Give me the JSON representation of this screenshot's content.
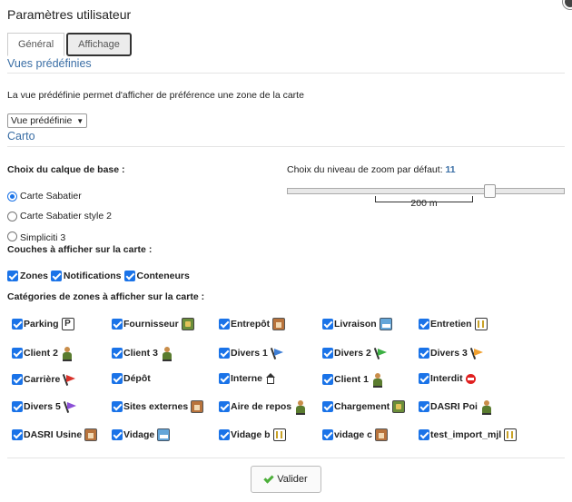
{
  "dialog": {
    "title": "Paramètres utilisateur"
  },
  "tabs": [
    {
      "label": "Général"
    },
    {
      "label": "Affichage"
    }
  ],
  "vues": {
    "section_title": "Vues prédéfinies",
    "description": "La vue prédéfinie permet d'afficher de préférence une zone de la carte",
    "select_value": "Vue prédéfinie"
  },
  "carto": {
    "section_title": "Carto",
    "base_layer_label": "Choix du calque de base :",
    "base_layers": [
      {
        "label": "Carte Sabatier",
        "checked": true
      },
      {
        "label": "Carte Sabatier style 2",
        "checked": false
      },
      {
        "label": "Simpliciti 3",
        "checked": false
      }
    ],
    "zoom_label": "Choix du niveau de zoom par défaut:",
    "zoom_value": "11",
    "scale_label": "200 m",
    "layers_label": "Couches à afficher sur la carte :",
    "layers": [
      "Zones",
      "Notifications",
      "Conteneurs"
    ],
    "categories_label": "Catégories de zones à afficher sur la carte :",
    "categories": [
      {
        "label": "Parking",
        "icon": "parking-icon"
      },
      {
        "label": "Fournisseur",
        "icon": "box-icon"
      },
      {
        "label": "Entrepôt",
        "icon": "warehouse-icon"
      },
      {
        "label": "Livraison",
        "icon": "truck-icon"
      },
      {
        "label": "Entretien",
        "icon": "tools-icon"
      },
      {
        "label": "Client 2",
        "icon": "person-icon"
      },
      {
        "label": "Client 3",
        "icon": "person-icon"
      },
      {
        "label": "Divers 1",
        "icon": "blue-flag-icon"
      },
      {
        "label": "Divers 2",
        "icon": "green-flag-icon"
      },
      {
        "label": "Divers 3",
        "icon": "orange-flag-icon"
      },
      {
        "label": "Carrière",
        "icon": "red-flag-icon"
      },
      {
        "label": "Dépôt",
        "icon": ""
      },
      {
        "label": "Interne",
        "icon": "home-icon"
      },
      {
        "label": "Client 1",
        "icon": "person-icon"
      },
      {
        "label": "Interdit",
        "icon": "forbidden-icon"
      },
      {
        "label": "Divers 5",
        "icon": "purple-flag-icon"
      },
      {
        "label": "Sites externes",
        "icon": "warehouse-icon"
      },
      {
        "label": "Aire de repos",
        "icon": "person-icon"
      },
      {
        "label": "Chargement",
        "icon": "box-icon"
      },
      {
        "label": "DASRI Poi",
        "icon": "person-icon"
      },
      {
        "label": "DASRI Usine",
        "icon": "warehouse-icon"
      },
      {
        "label": "Vidage",
        "icon": "truck-icon"
      },
      {
        "label": "Vidage b",
        "icon": "tools-icon"
      },
      {
        "label": "vidage c",
        "icon": "warehouse-icon"
      },
      {
        "label": "test_import_mjl",
        "icon": "tools-icon"
      }
    ]
  },
  "footer": {
    "submit_label": "Valider"
  },
  "colors": {
    "accent": "#1a73e8",
    "section": "#3a6ea5"
  }
}
